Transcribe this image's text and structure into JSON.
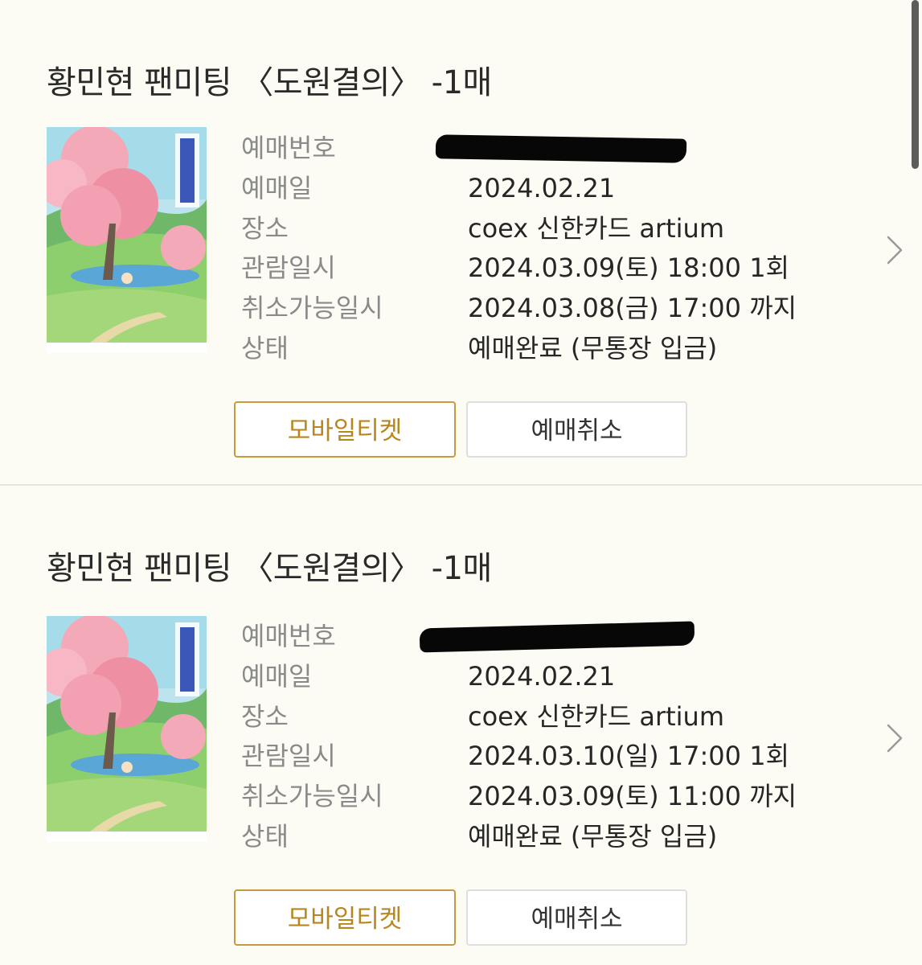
{
  "tickets": [
    {
      "title": "황민현 팬미팅 〈도원결의〉 -1매",
      "rows": [
        {
          "label": "예매번호",
          "value": ""
        },
        {
          "label": "예매일",
          "value": "2024.02.21"
        },
        {
          "label": "장소",
          "value": "coex 신한카드 artium"
        },
        {
          "label": "관람일시",
          "value": "2024.03.09(토) 18:00 1회"
        },
        {
          "label": "취소가능일시",
          "value": "2024.03.08(금) 17:00 까지"
        },
        {
          "label": "상태",
          "value": "예매완료 (무통장 입금)"
        }
      ],
      "buttons": {
        "mobile_ticket": "모바일티켓",
        "cancel": "예매취소"
      }
    },
    {
      "title": "황민현 팬미팅 〈도원결의〉 -1매",
      "rows": [
        {
          "label": "예매번호",
          "value": ""
        },
        {
          "label": "예매일",
          "value": "2024.02.21"
        },
        {
          "label": "장소",
          "value": "coex 신한카드 artium"
        },
        {
          "label": "관람일시",
          "value": "2024.03.10(일) 17:00 1회"
        },
        {
          "label": "취소가능일시",
          "value": "2024.03.09(토) 11:00 까지"
        },
        {
          "label": "상태",
          "value": "예매완료 (무통장 입금)"
        }
      ],
      "buttons": {
        "mobile_ticket": "모바일티켓",
        "cancel": "예매취소"
      }
    }
  ],
  "colors": {
    "background": "#fdfcf4",
    "accent_gold": "#c89a3e",
    "label_gray": "#8a8a8a"
  },
  "icons": {
    "chevron": "chevron-right-icon",
    "poster": "fanmeeting-poster"
  }
}
